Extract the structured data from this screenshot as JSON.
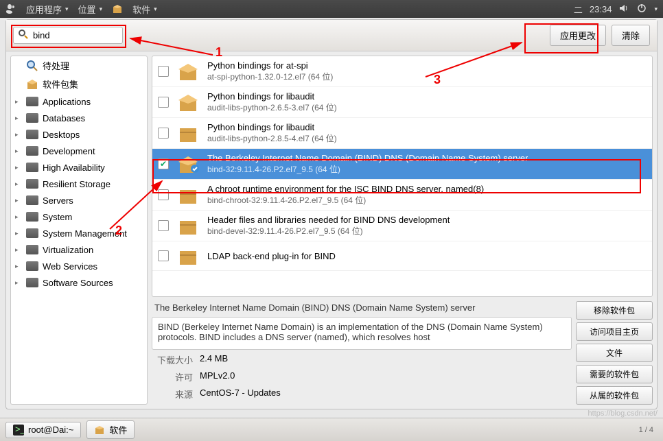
{
  "panel": {
    "apps": "应用程序",
    "places": "位置",
    "software": "软件",
    "day": "二",
    "time": "23:34"
  },
  "toolbar": {
    "search_value": "bind",
    "apply": "应用更改",
    "clear": "清除"
  },
  "sidebar": {
    "pending": "待处理",
    "collections": "软件包集",
    "cats": [
      "Applications",
      "Databases",
      "Desktops",
      "Development",
      "High Availability",
      "Resilient Storage",
      "Servers",
      "System",
      "System Management",
      "Virtualization",
      "Web Services",
      "Software Sources"
    ]
  },
  "packages": [
    {
      "title": "Python bindings for at-spi",
      "sub": "at-spi-python-1.32.0-12.el7 (64 位)",
      "checked": false,
      "selected": false,
      "icon": "open"
    },
    {
      "title": "Python bindings for libaudit",
      "sub": "audit-libs-python-2.6.5-3.el7 (64 位)",
      "checked": false,
      "selected": false,
      "icon": "open"
    },
    {
      "title": "Python bindings for libaudit",
      "sub": "audit-libs-python-2.8.5-4.el7 (64 位)",
      "checked": false,
      "selected": false,
      "icon": "closed"
    },
    {
      "title": "The Berkeley Internet Name Domain (BIND) DNS (Domain Name System) server",
      "sub": "bind-32:9.11.4-26.P2.el7_9.5 (64 位)",
      "checked": true,
      "selected": true,
      "icon": "install"
    },
    {
      "title": "A chroot runtime environment for the ISC BIND DNS server, named(8)",
      "sub": "bind-chroot-32:9.11.4-26.P2.el7_9.5 (64 位)",
      "checked": false,
      "selected": false,
      "icon": "closed"
    },
    {
      "title": "Header files and libraries needed for BIND DNS development",
      "sub": "bind-devel-32:9.11.4-26.P2.el7_9.5 (64 位)",
      "checked": false,
      "selected": false,
      "icon": "closed"
    },
    {
      "title": "LDAP back-end plug-in for BIND",
      "sub": "",
      "checked": false,
      "selected": false,
      "icon": "closed"
    }
  ],
  "detail": {
    "title": "The Berkeley Internet Name Domain (BIND) DNS (Domain Name System) server",
    "desc": "BIND (Berkeley Internet Name Domain) is an implementation of the DNS (Domain Name System) protocols. BIND includes a DNS server (named), which resolves host",
    "size_label": "下载大小",
    "size_value": "2.4 MB",
    "license_label": "许可",
    "license_value": "MPLv2.0",
    "source_label": "来源",
    "source_value": "CentOS-7 - Updates",
    "actions": {
      "remove": "移除软件包",
      "homepage": "访问项目主页",
      "files": "文件",
      "required": "需要的软件包",
      "dependent": "从属的软件包"
    }
  },
  "taskbar": {
    "terminal": "root@Dai:~",
    "software": "软件",
    "pager": "1 / 4"
  },
  "annotations": {
    "n1": "1",
    "n2": "2",
    "n3": "3"
  },
  "watermark": "https://blog.csdn.net/"
}
